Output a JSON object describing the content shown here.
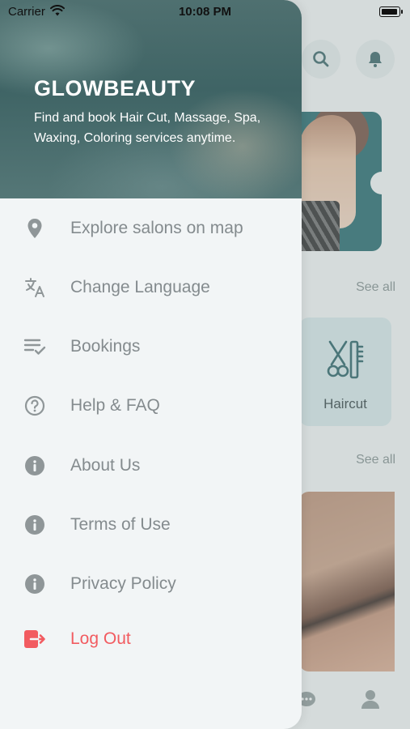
{
  "status_bar": {
    "carrier": "Carrier",
    "time": "10:08 PM"
  },
  "drawer": {
    "brand": "GLOWBEAUTY",
    "tagline": "Find and book Hair Cut, Massage, Spa, Waxing, Coloring services anytime.",
    "items": [
      {
        "label": "Explore salons on map",
        "icon": "location-pin-icon"
      },
      {
        "label": "Change Language",
        "icon": "translate-icon"
      },
      {
        "label": "Bookings",
        "icon": "checklist-icon"
      },
      {
        "label": "Help & FAQ",
        "icon": "help-circle-icon"
      },
      {
        "label": "About Us",
        "icon": "info-icon"
      },
      {
        "label": "Terms of Use",
        "icon": "info-icon"
      },
      {
        "label": "Privacy Policy",
        "icon": "info-icon"
      },
      {
        "label": "Log Out",
        "icon": "logout-icon"
      }
    ]
  },
  "background": {
    "see_all_1": "See all",
    "see_all_2": "See all",
    "category_label": "Haircut"
  },
  "colors": {
    "accent": "#1a6266",
    "danger": "#f25b60",
    "menu_text": "#848b8e"
  }
}
